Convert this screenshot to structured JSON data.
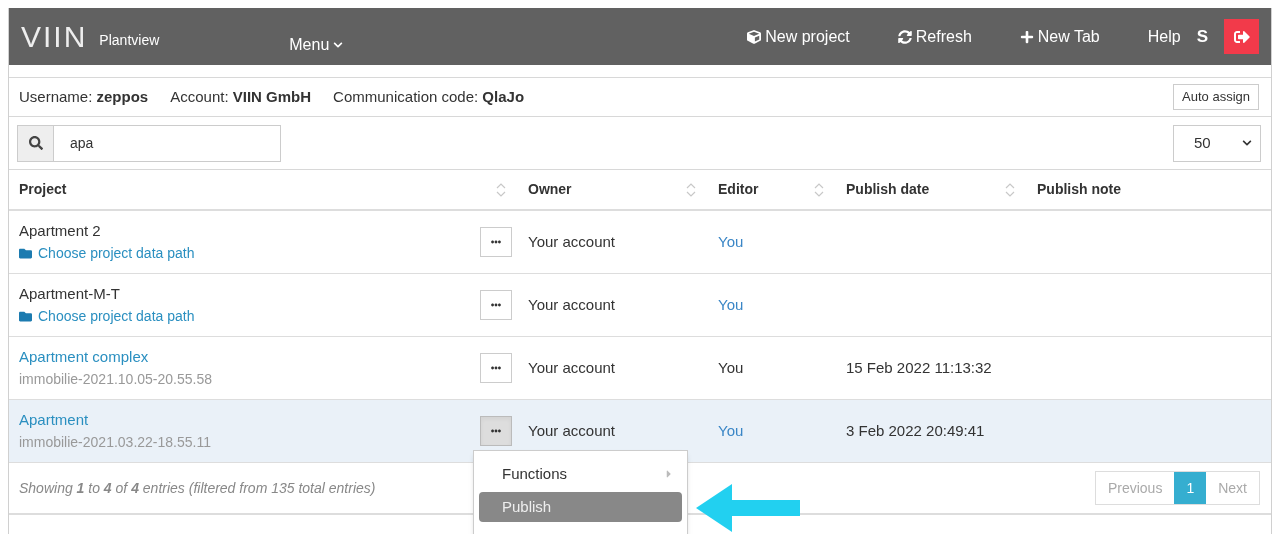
{
  "header": {
    "logo": "VIIN",
    "product": "Plantview",
    "menu": "Menu",
    "actions": [
      {
        "kind": "new_project",
        "label": "New project"
      },
      {
        "kind": "refresh",
        "label": "Refresh"
      },
      {
        "kind": "new_tab",
        "label": "New Tab"
      },
      {
        "kind": "plain",
        "label": "Help"
      },
      {
        "kind": "bold",
        "label": "S"
      }
    ]
  },
  "info": {
    "fields": [
      {
        "label": "Username:",
        "value": "zeppos"
      },
      {
        "label": "Account:",
        "value": "VIIN GmbH"
      },
      {
        "label": "Communication code:",
        "value": "QlaJo"
      }
    ],
    "auto_assign": "Auto assign"
  },
  "search": {
    "value": "apa"
  },
  "page_size": "50",
  "table": {
    "columns": [
      {
        "label": "Project",
        "sortable": true
      },
      {
        "label": "Owner",
        "sortable": true
      },
      {
        "label": "Editor",
        "sortable": true
      },
      {
        "label": "Publish date",
        "sortable": true
      },
      {
        "label": "Publish note",
        "sortable": false
      }
    ],
    "rows": [
      {
        "name": "Apartment 2",
        "name_link": false,
        "kind": "folder_link",
        "sub": "Choose project data path",
        "owner": "Your account",
        "editor": "You",
        "editor_link": true,
        "publish_date": "",
        "selected": false,
        "menu_open": false
      },
      {
        "name": "Apartment-M-T",
        "name_link": false,
        "kind": "folder_link",
        "sub": "Choose project data path",
        "owner": "Your account",
        "editor": "You",
        "editor_link": true,
        "publish_date": "",
        "selected": false,
        "menu_open": false
      },
      {
        "name": "Apartment complex",
        "name_link": true,
        "kind": "path",
        "sub": "immobilie-2021.10.05-20.55.58",
        "owner": "Your account",
        "editor": "You",
        "editor_link": false,
        "publish_date": "15 Feb 2022 11:13:32",
        "selected": false,
        "menu_open": false
      },
      {
        "name": "Apartment",
        "name_link": true,
        "kind": "path",
        "sub": "immobilie-2021.03.22-18.55.11",
        "owner": "Your account",
        "editor": "You",
        "editor_link": true,
        "publish_date": "3 Feb 2022 20:49:41",
        "selected": true,
        "menu_open": true
      }
    ]
  },
  "footer": {
    "summary": "Showing **1** to **4** of **4** entries (filtered from 135 total entries)",
    "pagination": [
      {
        "label": "Previous",
        "selected": false
      },
      {
        "label": "1",
        "selected": true
      },
      {
        "label": "Next",
        "selected": false
      }
    ]
  },
  "context_menu": {
    "items": [
      {
        "label": "Functions",
        "submenu": true,
        "selected": false
      },
      {
        "label": "Publish",
        "submenu": false,
        "selected": true
      }
    ]
  }
}
